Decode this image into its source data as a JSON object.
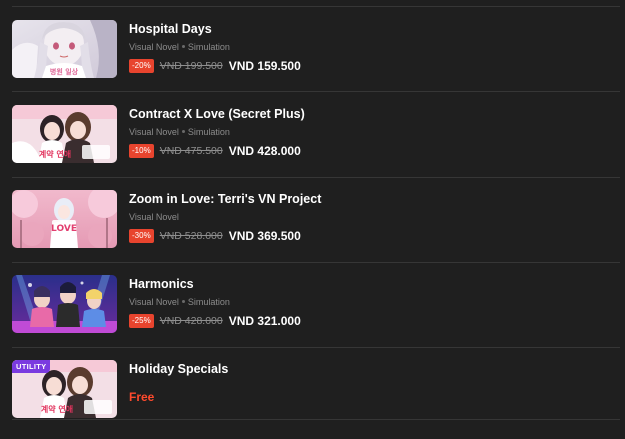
{
  "games": [
    {
      "title": "Hospital Days",
      "genres": [
        "Visual Novel",
        "Simulation"
      ],
      "discount": "-20%",
      "original_price": "VND 199.500",
      "price": "VND 159.500",
      "thumbnail": "hospital-days-cover-art",
      "thumbnail_text": "병원 일상"
    },
    {
      "title": "Contract X Love (Secret Plus)",
      "genres": [
        "Visual Novel",
        "Simulation"
      ],
      "discount": "-10%",
      "original_price": "VND 475.500",
      "price": "VND 428.000",
      "thumbnail": "contract-x-love-cover-art",
      "thumbnail_text": "계약 연애"
    },
    {
      "title": "Zoom in Love: Terri's VN Project",
      "genres": [
        "Visual Novel"
      ],
      "discount": "-30%",
      "original_price": "VND 528.000",
      "price": "VND 369.500",
      "thumbnail": "zoom-in-love-cover-art",
      "thumbnail_text": "LOVE"
    },
    {
      "title": "Harmonics",
      "genres": [
        "Visual Novel",
        "Simulation"
      ],
      "discount": "-25%",
      "original_price": "VND 428.000",
      "price": "VND 321.000",
      "thumbnail": "harmonics-cover-art",
      "thumbnail_text": ""
    },
    {
      "title": "Holiday Specials",
      "badge": "UTILITY",
      "price_label": "Free",
      "thumbnail": "holiday-specials-cover-art",
      "thumbnail_text": "계약 연애"
    }
  ],
  "colors": {
    "background": "#1f1f1f",
    "divider": "#363636",
    "discount_badge": "#e8442e",
    "free_text": "#ff4a2d",
    "utility_badge": "#7a3ae0"
  }
}
